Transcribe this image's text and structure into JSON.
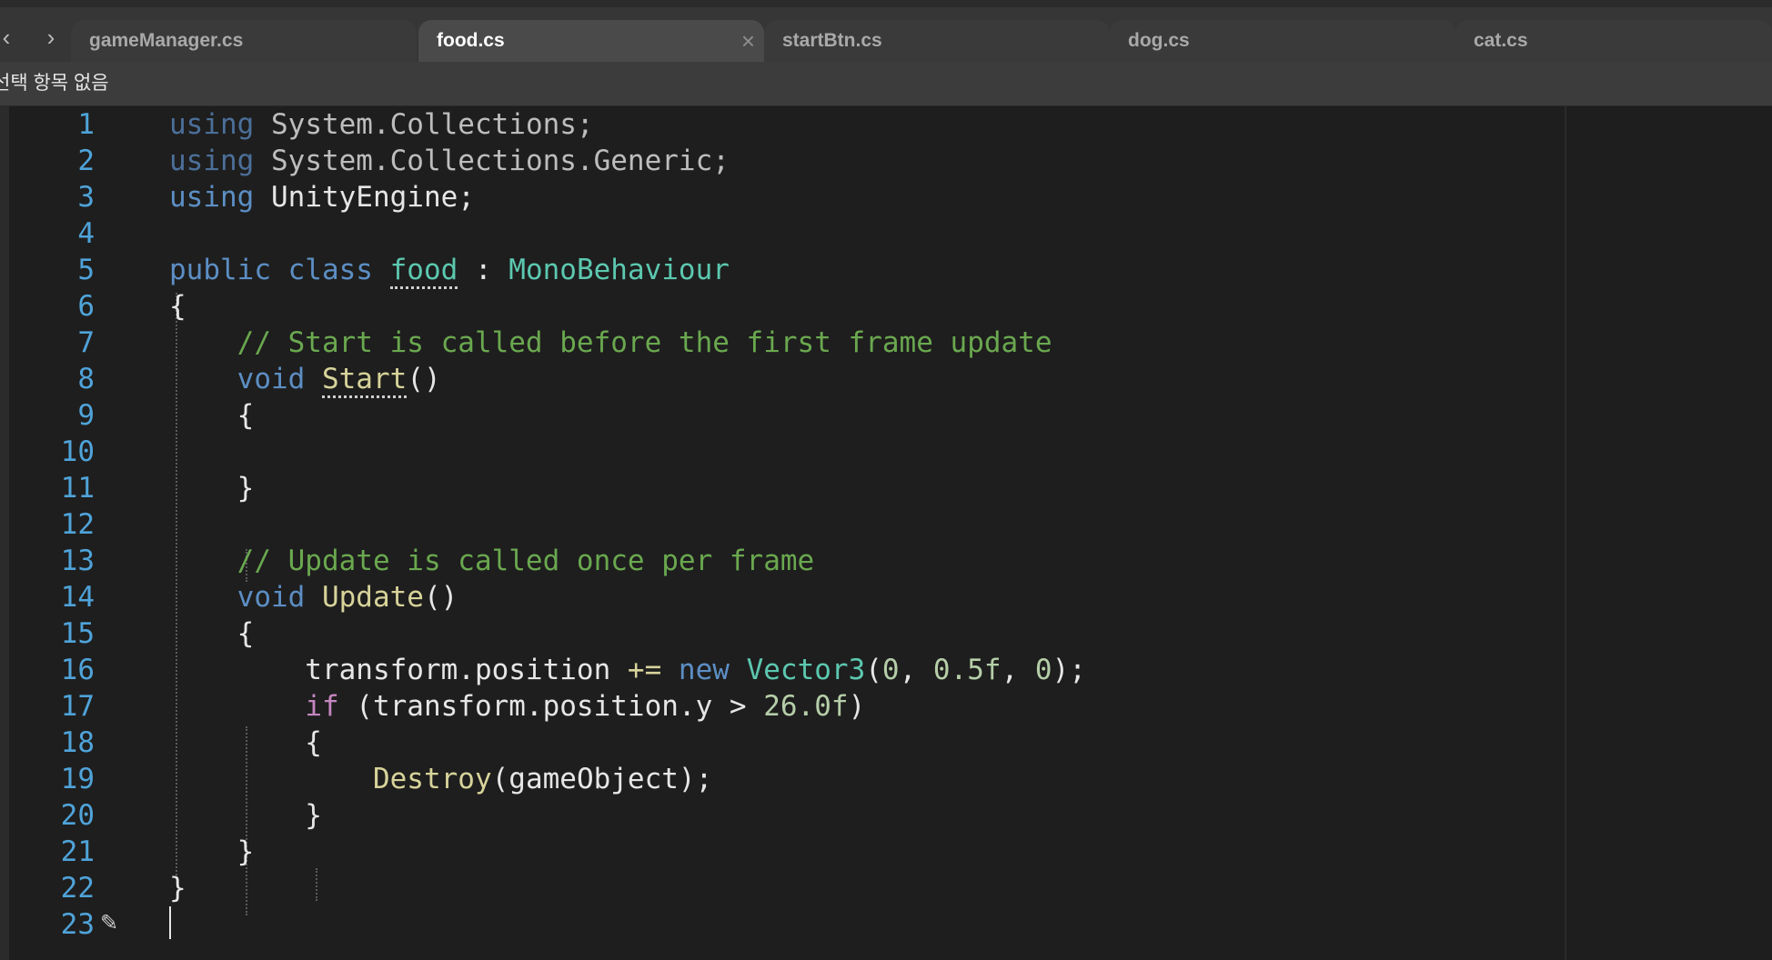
{
  "nav": {
    "back": "‹",
    "forward": "›"
  },
  "tabs": [
    {
      "label": "gameManager.cs",
      "active": false
    },
    {
      "label": "food.cs",
      "active": true
    },
    {
      "label": "startBtn.cs",
      "active": false
    },
    {
      "label": "dog.cs",
      "active": false
    },
    {
      "label": "cat.cs",
      "active": false
    }
  ],
  "tab_close_glyph": "×",
  "breadcrumb": "선택 항목 없음",
  "colors": {
    "keyword": "#5c8ec4",
    "keyword_dim": "#4b6f99",
    "type": "#5cc8b0",
    "comment": "#6aa84f",
    "method": "#d7d39a",
    "number": "#b5cea8",
    "control": "#c586c0",
    "text": "#e6e6e6",
    "line_number": "#4fa3d9"
  },
  "code_lines": [
    {
      "n": "1",
      "segs": [
        [
          "using",
          "kwdim"
        ],
        [
          " System.Collections;",
          "dim"
        ]
      ]
    },
    {
      "n": "2",
      "segs": [
        [
          "using",
          "kwdim"
        ],
        [
          " System.Collections.Generic;",
          "dim"
        ]
      ]
    },
    {
      "n": "3",
      "segs": [
        [
          "using",
          "kw"
        ],
        [
          " UnityEngine;",
          "text"
        ]
      ]
    },
    {
      "n": "4",
      "segs": []
    },
    {
      "n": "5",
      "segs": [
        [
          "public class ",
          "kw"
        ],
        [
          "food",
          "classname"
        ],
        [
          " : ",
          "text"
        ],
        [
          "MonoBehaviour",
          "type"
        ]
      ]
    },
    {
      "n": "6",
      "segs": [
        [
          "{",
          "text"
        ]
      ]
    },
    {
      "n": "7",
      "segs": [
        [
          "    // Start is called before the first frame update",
          "comment"
        ]
      ]
    },
    {
      "n": "8",
      "segs": [
        [
          "    ",
          "text"
        ],
        [
          "void",
          "kw"
        ],
        [
          " ",
          "text"
        ],
        [
          "Start",
          "methoddot"
        ],
        [
          "()",
          "text"
        ]
      ]
    },
    {
      "n": "9",
      "segs": [
        [
          "    {",
          "text"
        ]
      ]
    },
    {
      "n": "10",
      "segs": []
    },
    {
      "n": "11",
      "segs": [
        [
          "    }",
          "text"
        ]
      ]
    },
    {
      "n": "12",
      "segs": []
    },
    {
      "n": "13",
      "segs": [
        [
          "    // Update is called once per frame",
          "comment"
        ]
      ]
    },
    {
      "n": "14",
      "segs": [
        [
          "    ",
          "text"
        ],
        [
          "void",
          "kw"
        ],
        [
          " ",
          "text"
        ],
        [
          "Update",
          "method"
        ],
        [
          "()",
          "text"
        ]
      ]
    },
    {
      "n": "15",
      "segs": [
        [
          "    {",
          "text"
        ]
      ]
    },
    {
      "n": "16",
      "segs": [
        [
          "        transform.position ",
          "text"
        ],
        [
          "+=",
          "method"
        ],
        [
          " ",
          "text"
        ],
        [
          "new",
          "kw"
        ],
        [
          " ",
          "text"
        ],
        [
          "Vector3",
          "type"
        ],
        [
          "(",
          "text"
        ],
        [
          "0",
          "number"
        ],
        [
          ", ",
          "text"
        ],
        [
          "0.5f",
          "number"
        ],
        [
          ", ",
          "text"
        ],
        [
          "0",
          "number"
        ],
        [
          ");",
          "text"
        ]
      ]
    },
    {
      "n": "17",
      "segs": [
        [
          "        ",
          "text"
        ],
        [
          "if",
          "control"
        ],
        [
          " (transform.position.y > ",
          "text"
        ],
        [
          "26.0f",
          "number"
        ],
        [
          ")",
          "text"
        ]
      ]
    },
    {
      "n": "18",
      "segs": [
        [
          "        {",
          "text"
        ]
      ]
    },
    {
      "n": "19",
      "segs": [
        [
          "            ",
          "text"
        ],
        [
          "Destroy",
          "method"
        ],
        [
          "(gameObject);",
          "text"
        ]
      ]
    },
    {
      "n": "20",
      "segs": [
        [
          "        }",
          "text"
        ]
      ]
    },
    {
      "n": "21",
      "segs": [
        [
          "    }",
          "text"
        ]
      ]
    },
    {
      "n": "22",
      "segs": [
        [
          "}",
          "text"
        ]
      ]
    },
    {
      "n": "23",
      "segs": [],
      "cursor": true,
      "edit_icon": true
    }
  ],
  "edit_icon_glyph": "✎"
}
